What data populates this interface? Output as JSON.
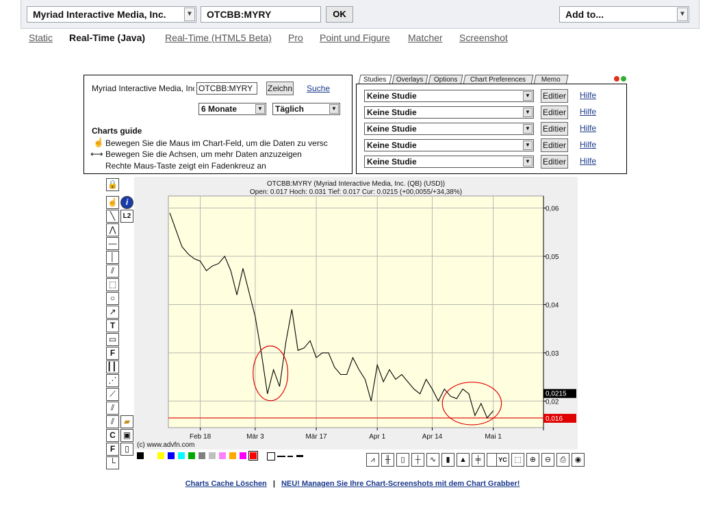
{
  "topbar": {
    "company": "Myriad Interactive Media, Inc.",
    "symbol": "OTCBB:MYRY",
    "ok_label": "OK",
    "add_to": "Add to..."
  },
  "nav": {
    "tabs": [
      "Static",
      "Real-Time (Java)",
      "Real-Time (HTML5 Beta)",
      "Pro",
      "Point und Figure",
      "Matcher",
      "Screenshot"
    ],
    "active": "Real-Time (Java)"
  },
  "controls": {
    "company_label": "Myriad Interactive Media, Inc",
    "symbol_value": "OTCBB:MYRY",
    "draw_button": "Zeichn",
    "search_link": "Suche",
    "period": "6 Monate",
    "interval": "Täglich",
    "guide_title": "Charts guide",
    "guide_lines": [
      "Bewegen Sie die Maus im Chart-Feld, um die Daten zu versc",
      "Bewegen Sie die Achsen, um mehr Daten anzuzeigen",
      "Rechte Maus-Taste zeigt ein Fadenkreuz an"
    ]
  },
  "studies": {
    "tabs": [
      "Studies",
      "Overlays",
      "Options",
      "Chart Preferences",
      "Memo"
    ],
    "active_tab": "Studies",
    "rows": [
      {
        "value": "Keine Studie",
        "edit": "Editier",
        "help": "Hilfe"
      },
      {
        "value": "Keine Studie",
        "edit": "Editier",
        "help": "Hilfe"
      },
      {
        "value": "Keine Studie",
        "edit": "Editier",
        "help": "Hilfe"
      },
      {
        "value": "Keine Studie",
        "edit": "Editier",
        "help": "Hilfe"
      },
      {
        "value": "Keine Studie",
        "edit": "Editier",
        "help": "Hilfe"
      }
    ]
  },
  "chart_data": {
    "type": "line",
    "title": "OTCBB:MYRY (Myriad Interactive Media, Inc. (QB) (USD))",
    "subtitle": "Open: 0.017 Hoch: 0.031 Tief: 0.017 Cur: 0.0215 (+00,0055/+34,38%)",
    "x_tick_labels": [
      "Feb 18",
      "Mär 3",
      "Mär 17",
      "Apr 1",
      "Apr 14",
      "Mai 1"
    ],
    "x_tick_index": [
      5,
      14,
      24,
      34,
      43,
      53
    ],
    "y_ticks": [
      "0,06",
      "0,05",
      "0,04",
      "0,03",
      "0,02"
    ],
    "y_tick_values": [
      0.06,
      0.05,
      0.04,
      0.03,
      0.02
    ],
    "ylim": [
      0.0145,
      0.0625
    ],
    "x_count": 62,
    "values": [
      0.059,
      0.0555,
      0.052,
      0.0505,
      0.0495,
      0.049,
      0.047,
      0.048,
      0.0485,
      0.05,
      0.047,
      0.042,
      0.0475,
      0.0425,
      0.0375,
      0.03,
      0.0215,
      0.0265,
      0.023,
      0.032,
      0.039,
      0.0305,
      0.031,
      0.0325,
      0.029,
      0.03,
      0.03,
      0.027,
      0.0255,
      0.0255,
      0.029,
      0.0265,
      0.0245,
      0.02,
      0.0275,
      0.024,
      0.0265,
      0.0245,
      0.0255,
      0.024,
      0.0225,
      0.0215,
      0.0245,
      0.0225,
      0.02,
      0.0225,
      0.021,
      0.0205,
      0.0225,
      0.0215,
      0.017,
      0.0195,
      0.0165,
      0.018
    ],
    "current_label": "0,0215",
    "current_value": 0.0215,
    "low_label": "0,016",
    "low_value": 0.0165,
    "copyright": "(c) www.advfn.com",
    "grid": true,
    "colors": {
      "background": "#ffffe0",
      "line": "#000000",
      "low_line": "#e00000",
      "circle": "#e00000"
    }
  },
  "toolbar": {
    "icons": [
      "lock-icon",
      "hand-icon",
      "info-icon",
      "line-icon",
      "level2-icon",
      "angle-icon",
      "horizontal-line-icon",
      "vertical-line-icon",
      "parallel-lines-icon",
      "zoom-box-icon",
      "magnifier-icon",
      "arrow-icon",
      "text-icon",
      "comment-icon",
      "fibonacci-icon",
      "cycle-lines-icon",
      "fan-icon",
      "regression-icon",
      "channel-icon",
      "save-icon",
      "folder-icon",
      "page-icon"
    ],
    "l2_label": "L2",
    "text_tool": "T",
    "fib_tool": "F",
    "close_tool": "C",
    "fill_tool": "F"
  },
  "colorbar": {
    "colors": [
      "#000000",
      "#ffffff",
      "#ffff00",
      "#0000ff",
      "#00ffff",
      "#00aa00",
      "#808080",
      "#c0c0c0",
      "#ff80ff",
      "#ffaa00",
      "#ff00ff",
      "#ff0000"
    ]
  },
  "footer": {
    "link1": "Charts Cache Löschen",
    "separator": "|",
    "link2": "NEU! Managen Sie Ihre Chart-Screenshots mit dem Chart Grabber!"
  }
}
